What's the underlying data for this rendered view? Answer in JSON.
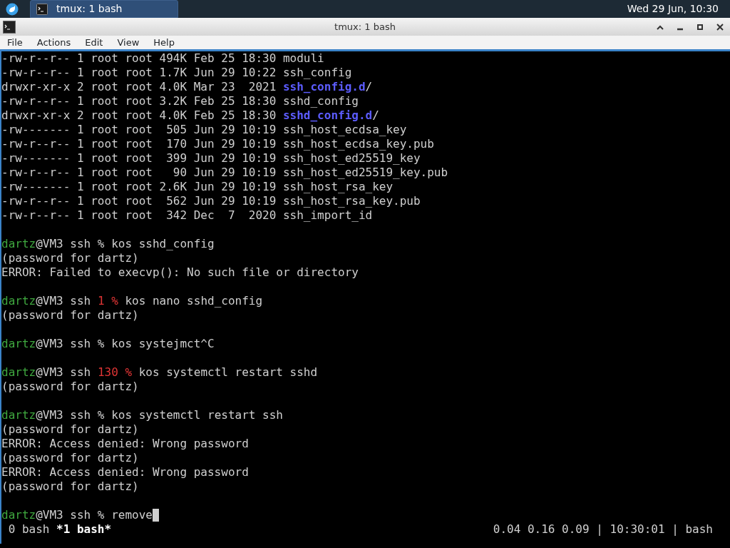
{
  "panel": {
    "task": {
      "title": "tmux: 1 bash",
      "selected": true
    },
    "clock": "Wed 29 Jun, 10:30"
  },
  "window": {
    "title": "tmux: 1 bash"
  },
  "menu": [
    "File",
    "Actions",
    "Edit",
    "View",
    "Help"
  ],
  "terminal": {
    "lines": [
      {
        "segments": [
          {
            "kind": "plain",
            "text": "-rw-r--r-- 1 root root 494K Feb 25 18:30 moduli"
          }
        ]
      },
      {
        "segments": [
          {
            "kind": "plain",
            "text": "-rw-r--r-- 1 root root 1.7K Jun 29 10:22 ssh_config"
          }
        ]
      },
      {
        "segments": [
          {
            "kind": "plain",
            "text": "drwxr-xr-x 2 root root 4.0K Mar 23  2021 "
          },
          {
            "kind": "dir",
            "text": "ssh_config.d"
          },
          {
            "kind": "plain",
            "text": "/"
          }
        ]
      },
      {
        "segments": [
          {
            "kind": "plain",
            "text": "-rw-r--r-- 1 root root 3.2K Feb 25 18:30 sshd_config"
          }
        ]
      },
      {
        "segments": [
          {
            "kind": "plain",
            "text": "drwxr-xr-x 2 root root 4.0K Feb 25 18:30 "
          },
          {
            "kind": "dir",
            "text": "sshd_config.d"
          },
          {
            "kind": "plain",
            "text": "/"
          }
        ]
      },
      {
        "segments": [
          {
            "kind": "plain",
            "text": "-rw------- 1 root root  505 Jun 29 10:19 ssh_host_ecdsa_key"
          }
        ]
      },
      {
        "segments": [
          {
            "kind": "plain",
            "text": "-rw-r--r-- 1 root root  170 Jun 29 10:19 ssh_host_ecdsa_key.pub"
          }
        ]
      },
      {
        "segments": [
          {
            "kind": "plain",
            "text": "-rw------- 1 root root  399 Jun 29 10:19 ssh_host_ed25519_key"
          }
        ]
      },
      {
        "segments": [
          {
            "kind": "plain",
            "text": "-rw-r--r-- 1 root root   90 Jun 29 10:19 ssh_host_ed25519_key.pub"
          }
        ]
      },
      {
        "segments": [
          {
            "kind": "plain",
            "text": "-rw------- 1 root root 2.6K Jun 29 10:19 ssh_host_rsa_key"
          }
        ]
      },
      {
        "segments": [
          {
            "kind": "plain",
            "text": "-rw-r--r-- 1 root root  562 Jun 29 10:19 ssh_host_rsa_key.pub"
          }
        ]
      },
      {
        "segments": [
          {
            "kind": "plain",
            "text": "-rw-r--r-- 1 root root  342 Dec  7  2020 ssh_import_id"
          }
        ]
      },
      {
        "gap_before": true,
        "segments": [
          {
            "kind": "user",
            "text": "dartz"
          },
          {
            "kind": "plain",
            "text": "@VM3 ssh % kos sshd_config"
          }
        ]
      },
      {
        "segments": [
          {
            "kind": "plain",
            "text": "(password for dartz)"
          }
        ]
      },
      {
        "segments": [
          {
            "kind": "plain",
            "text": "ERROR: Failed to execvp(): No such file or directory"
          }
        ]
      },
      {
        "gap_before": true,
        "segments": [
          {
            "kind": "user",
            "text": "dartz"
          },
          {
            "kind": "plain",
            "text": "@VM3 ssh "
          },
          {
            "kind": "code",
            "text": "1 %"
          },
          {
            "kind": "plain",
            "text": " kos nano sshd_config"
          }
        ]
      },
      {
        "segments": [
          {
            "kind": "plain",
            "text": "(password for dartz)"
          }
        ]
      },
      {
        "gap_before": true,
        "segments": [
          {
            "kind": "user",
            "text": "dartz"
          },
          {
            "kind": "plain",
            "text": "@VM3 ssh % kos systejmct^C"
          }
        ]
      },
      {
        "gap_before": true,
        "segments": [
          {
            "kind": "user",
            "text": "dartz"
          },
          {
            "kind": "plain",
            "text": "@VM3 ssh "
          },
          {
            "kind": "code",
            "text": "130 %"
          },
          {
            "kind": "plain",
            "text": " kos systemctl restart sshd"
          }
        ]
      },
      {
        "segments": [
          {
            "kind": "plain",
            "text": "(password for dartz)"
          }
        ]
      },
      {
        "gap_before": true,
        "segments": [
          {
            "kind": "user",
            "text": "dartz"
          },
          {
            "kind": "plain",
            "text": "@VM3 ssh % kos systemctl restart ssh"
          }
        ]
      },
      {
        "segments": [
          {
            "kind": "plain",
            "text": "(password for dartz)"
          }
        ]
      },
      {
        "segments": [
          {
            "kind": "plain",
            "text": "ERROR: Access denied: Wrong password"
          }
        ]
      },
      {
        "segments": [
          {
            "kind": "plain",
            "text": "(password for dartz)"
          }
        ]
      },
      {
        "segments": [
          {
            "kind": "plain",
            "text": "ERROR: Access denied: Wrong password"
          }
        ]
      },
      {
        "segments": [
          {
            "kind": "plain",
            "text": "(password for dartz)"
          }
        ]
      },
      {
        "gap_before": true,
        "segments": [
          {
            "kind": "user",
            "text": "dartz"
          },
          {
            "kind": "plain",
            "text": "@VM3 ssh % remove"
          }
        ],
        "cursor": true
      }
    ]
  },
  "status_bar": {
    "windows": [
      {
        "label": "0 bash",
        "selected": false
      },
      {
        "label": "*1 bash*",
        "selected": true
      }
    ],
    "right": "0.04 0.16 0.09 | 10:30:01 | bash"
  }
}
